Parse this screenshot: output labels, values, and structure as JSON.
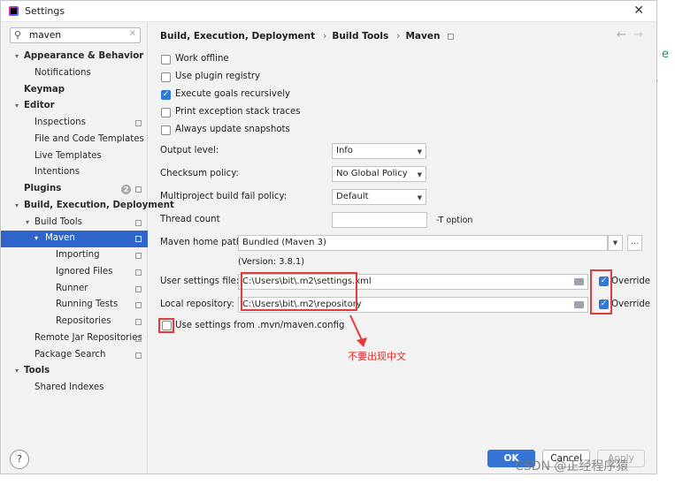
{
  "window": {
    "title": "Settings",
    "close": "✕"
  },
  "search": {
    "value": "maven",
    "icon": "search-icon",
    "clear": "✕"
  },
  "tree": [
    {
      "label": "Appearance & Behavior",
      "bold": true,
      "arrow": "▾",
      "depth": 0
    },
    {
      "label": "Notifications",
      "depth": 2
    },
    {
      "label": "Keymap",
      "bold": true,
      "depth": 1
    },
    {
      "label": "Editor",
      "bold": true,
      "arrow": "▾",
      "depth": 0
    },
    {
      "label": "Inspections",
      "depth": 2,
      "page": true
    },
    {
      "label": "File and Code Templates",
      "depth": 2
    },
    {
      "label": "Live Templates",
      "depth": 2
    },
    {
      "label": "Intentions",
      "depth": 2
    },
    {
      "label": "Plugins",
      "bold": true,
      "depth": 1,
      "badge": "2",
      "page": true
    },
    {
      "label": "Build, Execution, Deployment",
      "bold": true,
      "arrow": "▾",
      "depth": 0
    },
    {
      "label": "Build Tools",
      "arrow": "▾",
      "depth": 2,
      "page": true
    },
    {
      "label": "Maven",
      "arrow": "▾",
      "depth": 3,
      "page": true,
      "selected": true
    },
    {
      "label": "Importing",
      "depth": 4,
      "page": true
    },
    {
      "label": "Ignored Files",
      "depth": 4,
      "page": true
    },
    {
      "label": "Runner",
      "depth": 4,
      "page": true
    },
    {
      "label": "Running Tests",
      "depth": 4,
      "page": true
    },
    {
      "label": "Repositories",
      "depth": 4,
      "page": true
    },
    {
      "label": "Remote Jar Repositories",
      "depth": 2,
      "page": true
    },
    {
      "label": "Package Search",
      "depth": 2,
      "page": true
    },
    {
      "label": "Tools",
      "bold": true,
      "arrow": "▾",
      "depth": 0
    },
    {
      "label": "Shared Indexes",
      "depth": 2
    }
  ],
  "breadcrumb": {
    "part1": "Build, Execution, Deployment",
    "part2": "Build Tools",
    "part3": "Maven",
    "sep": "›"
  },
  "nav": {
    "back": "←",
    "forward": "→"
  },
  "checkboxes": {
    "work_offline": {
      "label": "Work offline",
      "checked": false
    },
    "use_plugin_registry": {
      "label": "Use plugin registry",
      "checked": false
    },
    "execute_goals_recursively": {
      "label": "Execute goals recursively",
      "checked": true
    },
    "print_exception": {
      "label": "Print exception stack traces",
      "checked": false
    },
    "always_update": {
      "label": "Always update snapshots",
      "checked": false
    }
  },
  "fields": {
    "output_level": {
      "label": "Output level:",
      "value": "Info"
    },
    "checksum_policy": {
      "label": "Checksum policy:",
      "value": "No Global Policy"
    },
    "multiproject_fail": {
      "label": "Multiproject build fail policy:",
      "value": "Default"
    },
    "thread_count": {
      "label": "Thread count",
      "value": "",
      "suffix": "-T option"
    },
    "maven_home": {
      "label": "Maven home path:",
      "value": "Bundled (Maven 3)",
      "ellipsis": "...",
      "version": "(Version: 3.8.1)"
    },
    "user_settings": {
      "label": "User settings file:",
      "value": "C:\\Users\\bit\\.m2\\settings.xml",
      "override_label": "Override",
      "override": true
    },
    "local_repo": {
      "label": "Local repository:",
      "value": "C:\\Users\\bit\\.m2\\repository",
      "override_label": "Override",
      "override": true
    },
    "mvn_config": {
      "label": "Use settings from .mvn/maven.config",
      "checked": false
    }
  },
  "annotation": {
    "text": "不要出现中文",
    "color": "#e02b2b"
  },
  "buttons": {
    "ok": "OK",
    "cancel": "Cancel",
    "apply": "Apply",
    "help": "?"
  },
  "watermark": "CSDN @正经程序猿",
  "edge_text": {
    "letter": "e",
    "dot": "."
  },
  "colors": {
    "selection": "#2f65ca",
    "accent": "#3574d4",
    "checkbox_on": "#2f7bd8",
    "annotation_red": "#e33a3a"
  }
}
